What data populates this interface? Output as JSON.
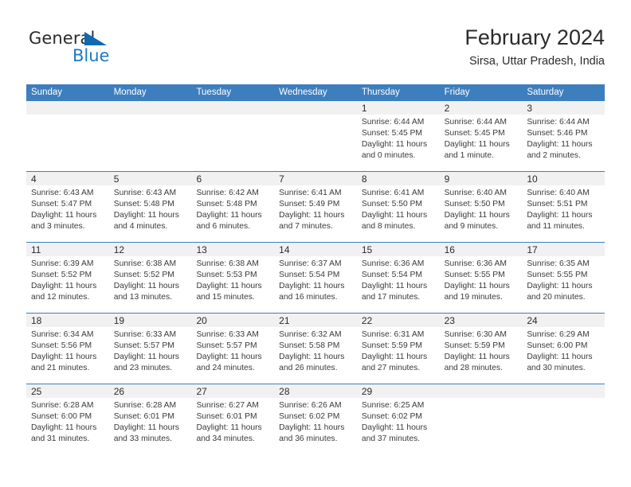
{
  "brand": {
    "name_part1": "General",
    "name_part2": "Blue",
    "accent_color": "#1b7ac4",
    "triangle_color": "#1268b3"
  },
  "header": {
    "title": "February 2024",
    "subtitle": "Sirsa, Uttar Pradesh, India"
  },
  "colors": {
    "header_row": "#3d7ebe",
    "day_band": "#f1f1f1",
    "row_divider": "#3d7ebe"
  },
  "weekdays": [
    "Sunday",
    "Monday",
    "Tuesday",
    "Wednesday",
    "Thursday",
    "Friday",
    "Saturday"
  ],
  "weeks": [
    [
      {
        "empty": true
      },
      {
        "empty": true
      },
      {
        "empty": true
      },
      {
        "empty": true
      },
      {
        "day": "1",
        "sunrise": "Sunrise: 6:44 AM",
        "sunset": "Sunset: 5:45 PM",
        "daylight_line1": "Daylight: 11 hours",
        "daylight_line2": "and 0 minutes."
      },
      {
        "day": "2",
        "sunrise": "Sunrise: 6:44 AM",
        "sunset": "Sunset: 5:45 PM",
        "daylight_line1": "Daylight: 11 hours",
        "daylight_line2": "and 1 minute."
      },
      {
        "day": "3",
        "sunrise": "Sunrise: 6:44 AM",
        "sunset": "Sunset: 5:46 PM",
        "daylight_line1": "Daylight: 11 hours",
        "daylight_line2": "and 2 minutes."
      }
    ],
    [
      {
        "day": "4",
        "sunrise": "Sunrise: 6:43 AM",
        "sunset": "Sunset: 5:47 PM",
        "daylight_line1": "Daylight: 11 hours",
        "daylight_line2": "and 3 minutes."
      },
      {
        "day": "5",
        "sunrise": "Sunrise: 6:43 AM",
        "sunset": "Sunset: 5:48 PM",
        "daylight_line1": "Daylight: 11 hours",
        "daylight_line2": "and 4 minutes."
      },
      {
        "day": "6",
        "sunrise": "Sunrise: 6:42 AM",
        "sunset": "Sunset: 5:48 PM",
        "daylight_line1": "Daylight: 11 hours",
        "daylight_line2": "and 6 minutes."
      },
      {
        "day": "7",
        "sunrise": "Sunrise: 6:41 AM",
        "sunset": "Sunset: 5:49 PM",
        "daylight_line1": "Daylight: 11 hours",
        "daylight_line2": "and 7 minutes."
      },
      {
        "day": "8",
        "sunrise": "Sunrise: 6:41 AM",
        "sunset": "Sunset: 5:50 PM",
        "daylight_line1": "Daylight: 11 hours",
        "daylight_line2": "and 8 minutes."
      },
      {
        "day": "9",
        "sunrise": "Sunrise: 6:40 AM",
        "sunset": "Sunset: 5:50 PM",
        "daylight_line1": "Daylight: 11 hours",
        "daylight_line2": "and 9 minutes."
      },
      {
        "day": "10",
        "sunrise": "Sunrise: 6:40 AM",
        "sunset": "Sunset: 5:51 PM",
        "daylight_line1": "Daylight: 11 hours",
        "daylight_line2": "and 11 minutes."
      }
    ],
    [
      {
        "day": "11",
        "sunrise": "Sunrise: 6:39 AM",
        "sunset": "Sunset: 5:52 PM",
        "daylight_line1": "Daylight: 11 hours",
        "daylight_line2": "and 12 minutes."
      },
      {
        "day": "12",
        "sunrise": "Sunrise: 6:38 AM",
        "sunset": "Sunset: 5:52 PM",
        "daylight_line1": "Daylight: 11 hours",
        "daylight_line2": "and 13 minutes."
      },
      {
        "day": "13",
        "sunrise": "Sunrise: 6:38 AM",
        "sunset": "Sunset: 5:53 PM",
        "daylight_line1": "Daylight: 11 hours",
        "daylight_line2": "and 15 minutes."
      },
      {
        "day": "14",
        "sunrise": "Sunrise: 6:37 AM",
        "sunset": "Sunset: 5:54 PM",
        "daylight_line1": "Daylight: 11 hours",
        "daylight_line2": "and 16 minutes."
      },
      {
        "day": "15",
        "sunrise": "Sunrise: 6:36 AM",
        "sunset": "Sunset: 5:54 PM",
        "daylight_line1": "Daylight: 11 hours",
        "daylight_line2": "and 17 minutes."
      },
      {
        "day": "16",
        "sunrise": "Sunrise: 6:36 AM",
        "sunset": "Sunset: 5:55 PM",
        "daylight_line1": "Daylight: 11 hours",
        "daylight_line2": "and 19 minutes."
      },
      {
        "day": "17",
        "sunrise": "Sunrise: 6:35 AM",
        "sunset": "Sunset: 5:55 PM",
        "daylight_line1": "Daylight: 11 hours",
        "daylight_line2": "and 20 minutes."
      }
    ],
    [
      {
        "day": "18",
        "sunrise": "Sunrise: 6:34 AM",
        "sunset": "Sunset: 5:56 PM",
        "daylight_line1": "Daylight: 11 hours",
        "daylight_line2": "and 21 minutes."
      },
      {
        "day": "19",
        "sunrise": "Sunrise: 6:33 AM",
        "sunset": "Sunset: 5:57 PM",
        "daylight_line1": "Daylight: 11 hours",
        "daylight_line2": "and 23 minutes."
      },
      {
        "day": "20",
        "sunrise": "Sunrise: 6:33 AM",
        "sunset": "Sunset: 5:57 PM",
        "daylight_line1": "Daylight: 11 hours",
        "daylight_line2": "and 24 minutes."
      },
      {
        "day": "21",
        "sunrise": "Sunrise: 6:32 AM",
        "sunset": "Sunset: 5:58 PM",
        "daylight_line1": "Daylight: 11 hours",
        "daylight_line2": "and 26 minutes."
      },
      {
        "day": "22",
        "sunrise": "Sunrise: 6:31 AM",
        "sunset": "Sunset: 5:59 PM",
        "daylight_line1": "Daylight: 11 hours",
        "daylight_line2": "and 27 minutes."
      },
      {
        "day": "23",
        "sunrise": "Sunrise: 6:30 AM",
        "sunset": "Sunset: 5:59 PM",
        "daylight_line1": "Daylight: 11 hours",
        "daylight_line2": "and 28 minutes."
      },
      {
        "day": "24",
        "sunrise": "Sunrise: 6:29 AM",
        "sunset": "Sunset: 6:00 PM",
        "daylight_line1": "Daylight: 11 hours",
        "daylight_line2": "and 30 minutes."
      }
    ],
    [
      {
        "day": "25",
        "sunrise": "Sunrise: 6:28 AM",
        "sunset": "Sunset: 6:00 PM",
        "daylight_line1": "Daylight: 11 hours",
        "daylight_line2": "and 31 minutes."
      },
      {
        "day": "26",
        "sunrise": "Sunrise: 6:28 AM",
        "sunset": "Sunset: 6:01 PM",
        "daylight_line1": "Daylight: 11 hours",
        "daylight_line2": "and 33 minutes."
      },
      {
        "day": "27",
        "sunrise": "Sunrise: 6:27 AM",
        "sunset": "Sunset: 6:01 PM",
        "daylight_line1": "Daylight: 11 hours",
        "daylight_line2": "and 34 minutes."
      },
      {
        "day": "28",
        "sunrise": "Sunrise: 6:26 AM",
        "sunset": "Sunset: 6:02 PM",
        "daylight_line1": "Daylight: 11 hours",
        "daylight_line2": "and 36 minutes."
      },
      {
        "day": "29",
        "sunrise": "Sunrise: 6:25 AM",
        "sunset": "Sunset: 6:02 PM",
        "daylight_line1": "Daylight: 11 hours",
        "daylight_line2": "and 37 minutes."
      },
      {
        "empty": true
      },
      {
        "empty": true
      }
    ]
  ]
}
